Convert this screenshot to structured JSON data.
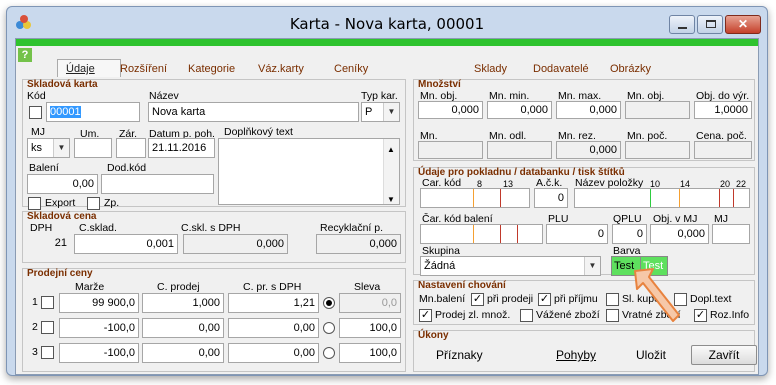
{
  "window": {
    "title": "Karta - Nova karta, 00001"
  },
  "tabs": [
    "Údaje",
    "Rozšíření",
    "Kategorie",
    "Váz.karty",
    "Ceníky",
    "Sklady",
    "Dodavatelé",
    "Obrázky"
  ],
  "skladova_karta": {
    "title": "Skladová karta",
    "kod_label": "Kód",
    "kod_value": "00001",
    "nazev_label": "Název",
    "nazev_value": "Nova karta",
    "typ_label": "Typ kar.",
    "typ_value": "P",
    "mj_label": "MJ",
    "mj_value": "ks",
    "um_label": "Um.",
    "zar_label": "Zár.",
    "datum_label": "Datum p. poh.",
    "datum_value": "21.11.2016",
    "dopl_label": "Doplňkový text",
    "baleni_label": "Balení",
    "baleni_value": "0,00",
    "dodkod_label": "Dod.kód",
    "export_label": "Export",
    "zp_label": "Zp."
  },
  "skladova_cena": {
    "title": "Skladová cena",
    "dph_label": "DPH",
    "dph_value": "21",
    "csklad_label": "C.sklad.",
    "csklad_value": "0,001",
    "cskl_dph_label": "C.skl. s DPH",
    "cskl_dph_value": "0,000",
    "recykl_label": "Recyklační p.",
    "recykl_value": "0,000"
  },
  "prodejni_ceny": {
    "title": "Prodejní ceny",
    "headers": [
      "Marže",
      "C. prodej",
      "C. pr. s DPH",
      "Sleva"
    ],
    "rows": [
      {
        "num": "1",
        "marze": "99 900,0",
        "cprodej": "1,000",
        "cdph": "1,21",
        "sleva": "0,0"
      },
      {
        "num": "2",
        "marze": "-100,0",
        "cprodej": "0,00",
        "cdph": "0,00",
        "sleva": "100,0"
      },
      {
        "num": "3",
        "marze": "-100,0",
        "cprodej": "0,00",
        "cdph": "0,00",
        "sleva": "100,0"
      }
    ]
  },
  "mnozstvi": {
    "title": "Množství",
    "row1_labels": [
      "Mn. obj.",
      "Mn. min.",
      "Mn. max.",
      "Mn. obj.",
      "Obj. do výr."
    ],
    "row1_values": [
      "0,000",
      "0,000",
      "0,000",
      "",
      "1,0000"
    ],
    "row2_labels": [
      "Mn.",
      "Mn. odl.",
      "Mn. rez.",
      "Mn. poč.",
      "Cena. poč."
    ],
    "row2_values": [
      "",
      "",
      "0,000",
      "",
      ""
    ]
  },
  "pokladna": {
    "title": "Údaje pro pokladnu / databanku / tisk štítků",
    "carkod_label": "Car. kód",
    "tick8": "8",
    "tick13": "13",
    "ack_label": "A.č.k.",
    "ack_value": "0",
    "nazev_polozky_label": "Název položky",
    "tick10": "10",
    "tick14": "14",
    "tick20": "20",
    "tick22": "22",
    "carkod_baleni_label": "Čar. kód balení",
    "plu_label": "PLU",
    "plu_value": "0",
    "qplu_label": "QPLU",
    "qplu_value": "0",
    "objmj_label": "Obj. v MJ",
    "objmj_value": "0,000",
    "mj_label": "MJ",
    "skupina_label": "Skupina",
    "skupina_value": "Žádná",
    "barva_label": "Barva",
    "barva_test1": "Test",
    "barva_test2": "Test",
    "color_green": "#5ee05e"
  },
  "nastaveni": {
    "title": "Nastavení chování",
    "mn_baleni_label": "Mn.balení",
    "items": [
      {
        "label": "při prodeji",
        "checked": true
      },
      {
        "label": "při příjmu",
        "checked": true
      },
      {
        "label": "Sl. kupo",
        "checked": false
      },
      {
        "label": "Dopl.text",
        "checked": false
      },
      {
        "label": "Prodej zl. množ.",
        "checked": true
      },
      {
        "label": "Vážené zboží",
        "checked": false
      },
      {
        "label": "Vratné zboží",
        "checked": false
      },
      {
        "label": "Roz.Info",
        "checked": true
      }
    ]
  },
  "ukony": {
    "title": "Úkony",
    "priznaky": "Příznaky",
    "pohyby": "Pohyby",
    "ulozit": "Uložit",
    "zavrit": "Zavřít"
  }
}
